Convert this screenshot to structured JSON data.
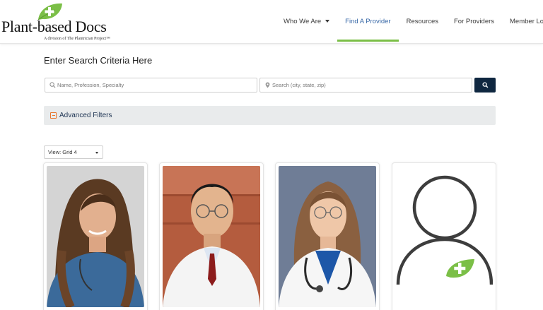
{
  "brand": {
    "title": "Plant-based Docs",
    "subtitle": "A division of The Plantrician Project™",
    "leaf_color": "#7bbf47"
  },
  "nav": {
    "items": [
      {
        "label": "Who We Are",
        "has_dropdown": true,
        "active": false
      },
      {
        "label": "Find A Provider",
        "has_dropdown": false,
        "active": true
      },
      {
        "label": "Resources",
        "has_dropdown": false,
        "active": false
      },
      {
        "label": "For Providers",
        "has_dropdown": false,
        "active": false
      },
      {
        "label": "Member Login",
        "has_dropdown": false,
        "active": false
      }
    ],
    "active_color": "#3a6aa8",
    "underline_color": "#7bbf47"
  },
  "search": {
    "title": "Enter Search Criteria Here",
    "name_placeholder": "Name, Profession, Specialty",
    "location_placeholder": "Search (city, state, zip)",
    "button_icon": "search-icon",
    "button_color": "#0f2740"
  },
  "filters": {
    "label": "Advanced Filters",
    "icon": "expand-box-icon",
    "icon_color": "#e8752c"
  },
  "view": {
    "selected": "View: Grid 4"
  },
  "providers": [
    {
      "photo": "woman-long-brown-hair-photo"
    },
    {
      "photo": "man-glasses-white-coat-photo"
    },
    {
      "photo": "woman-stethoscope-white-coat-photo"
    },
    {
      "photo": "placeholder-avatar-icon"
    }
  ]
}
